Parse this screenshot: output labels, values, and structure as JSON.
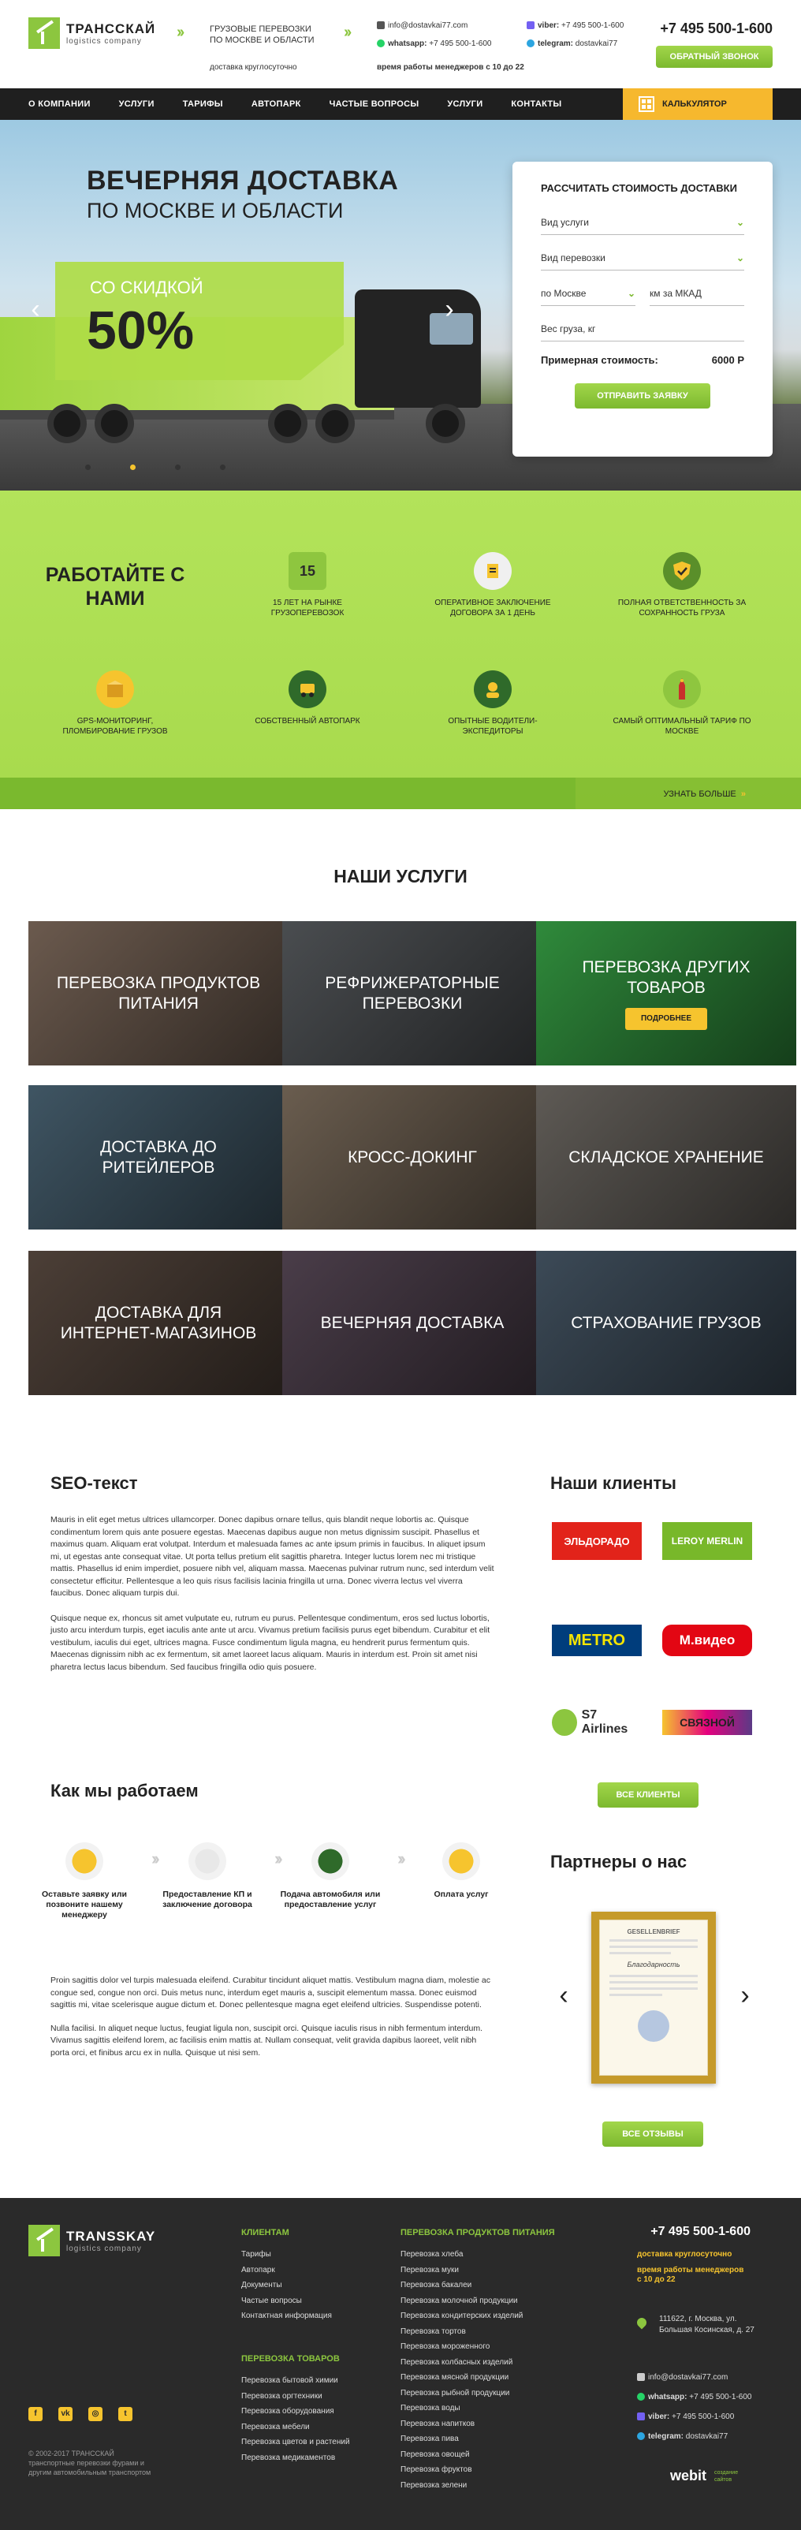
{
  "header": {
    "brand_name": "ТРАНССКАЙ",
    "brand_sub": "logistics company",
    "tagline_line1": "ГРУЗОВЫЕ ПЕРЕВОЗКИ",
    "tagline_line2": "ПО МОСКВЕ И ОБЛАСТИ",
    "hours_note": "доставка круглосуточно",
    "email": "info@dostavkai77.com",
    "whatsapp_label": "whatsapp:",
    "whatsapp": "+7 495 500-1-600",
    "manager_hours": "время работы менеджеров с 10 до 22",
    "viber_label": "viber:",
    "viber": "+7 495 500-1-600",
    "telegram_label": "telegram:",
    "telegram": "dostavkai77",
    "phone": "+7 495 500-1-600",
    "callback_label": "ОБРАТНЫЙ ЗВОНОК"
  },
  "nav": {
    "items": [
      "О КОМПАНИИ",
      "УСЛУГИ",
      "ТАРИФЫ",
      "АВТОПАРК",
      "ЧАСТЫЕ ВОПРОСЫ",
      "УСЛУГИ",
      "КОНТАКТЫ"
    ],
    "calculator_label": "КАЛЬКУЛЯТОР"
  },
  "hero": {
    "title": "ВЕЧЕРНЯЯ ДОСТАВКА",
    "subtitle": "ПО МОСКВЕ И ОБЛАСТИ",
    "discount_label": "СО СКИДКОЙ",
    "discount_value": "50%",
    "slides_total": 4,
    "active_slide": 2
  },
  "calc_form": {
    "title": "РАССЧИТАТЬ СТОИМОСТЬ ДОСТАВКИ",
    "service_field": "Вид услуги",
    "transport_field": "Вид перевозки",
    "region_field": "по Москве",
    "distance_placeholder": "км за МКАД",
    "weight_placeholder": "Вес груза, кг",
    "total_label": "Примерная стоимость:",
    "total_value": "6000 Р",
    "submit_label": "ОТПРАВИТЬ ЗАЯВКУ"
  },
  "benefits": {
    "title": "РАБОТАЙТЕ С НАМИ",
    "items": [
      {
        "label": "15 ЛЕТ НА РЫНКЕ ГРУЗОПЕРЕВОЗОК",
        "icon": "15-years-icon"
      },
      {
        "label": "ОПЕРАТИВНОЕ ЗАКЛЮЧЕНИЕ ДОГОВОРА ЗА 1 ДЕНЬ",
        "icon": "contract-icon"
      },
      {
        "label": "ПОЛНАЯ ОТВЕТСТВЕННОСТЬ ЗА СОХРАННОСТЬ ГРУЗА",
        "icon": "shield-icon"
      },
      {
        "label": "GPS-МОНИТОРИНГ, ПЛОМБИРОВАНИЕ ГРУЗОВ",
        "icon": "gps-box-icon"
      },
      {
        "label": "СОБСТВЕННЫЙ АВТОПАРК",
        "icon": "truck-icon"
      },
      {
        "label": "ОПЫТНЫЕ ВОДИТЕЛИ-ЭКСПЕДИТОРЫ",
        "icon": "driver-icon"
      },
      {
        "label": "САМЫЙ ОПТИМАЛЬНЫЙ ТАРИФ ПО МОСКВЕ",
        "icon": "kremlin-icon"
      }
    ],
    "learn_more": "УЗНАТЬ БОЛЬШЕ"
  },
  "services": {
    "title": "НАШИ УСЛУГИ",
    "items": [
      {
        "label": "ПЕРЕВОЗКА ПРОДУКТОВ ПИТАНИЯ",
        "color": "#6b5a4e"
      },
      {
        "label": "РЕФРИЖЕРАТОРНЫЕ ПЕРЕВОЗКИ",
        "color": "#4a4d50"
      },
      {
        "label": "ПЕРЕВОЗКА ДРУГИХ ТОВАРОВ",
        "color": "#2f8a3b"
      },
      {
        "label": "ДОСТАВКА ДО РИТЕЙЛЕРОВ",
        "color": "#3f5563"
      },
      {
        "label": "КРОСС-ДОКИНГ",
        "color": "#6a5d4f"
      },
      {
        "label": "СКЛАДСКОЕ ХРАНЕНИЕ",
        "color": "#5e5a55"
      },
      {
        "label": "ДОСТАВКА ДЛЯ ИНТЕРНЕТ-МАГАЗИНОВ",
        "color": "#4c3f37"
      },
      {
        "label": "ВЕЧЕРНЯЯ ДОСТАВКА",
        "color": "#4a3d49"
      },
      {
        "label": "СТРАХОВАНИЕ ГРУЗОВ",
        "color": "#3c4a57"
      }
    ],
    "more_label": "ПОДРОБНЕЕ"
  },
  "seo": {
    "title": "SEO-текст",
    "p1": "Mauris in elit eget metus ultrices ullamcorper. Donec dapibus ornare tellus, quis blandit neque lobortis ac. Quisque condimentum lorem quis ante posuere egestas. Maecenas dapibus augue non metus dignissim suscipit. Phasellus et maximus quam. Aliquam erat volutpat. Interdum et malesuada fames ac ante ipsum primis in faucibus. In aliquet ipsum mi, ut egestas ante consequat vitae. Ut porta tellus pretium elit sagittis pharetra. Integer luctus lorem nec mi tristique mattis. Phasellus id enim imperdiet, posuere nibh vel, aliquam massa. Maecenas pulvinar rutrum nunc, sed interdum velit consectetur efficitur. Pellentesque a leo quis risus facilisis lacinia fringilla ut urna. Donec viverra lectus vel viverra faucibus. Donec aliquam turpis dui.",
    "p2": "Quisque neque ex, rhoncus sit amet vulputate eu, rutrum eu purus. Pellentesque condimentum, eros sed luctus lobortis, justo arcu interdum turpis, eget iaculis ante ante ut arcu. Vivamus pretium facilisis purus eget bibendum. Curabitur et elit vestibulum, iaculis dui eget, ultrices magna. Fusce condimentum ligula magna, eu hendrerit purus fermentum quis. Maecenas dignissim nibh ac ex fermentum, sit amet laoreet lacus aliquam. Mauris in interdum est. Proin sit amet nisi pharetra lectus lacus bibendum. Sed faucibus fringilla odio quis posuere."
  },
  "clients": {
    "title": "Наши клиенты",
    "logos": [
      {
        "name": "ЭЛЬДОРАДО",
        "color": "#e2231a"
      },
      {
        "name": "LEROY MERLIN",
        "color": "#78b82a"
      },
      {
        "name": "METRO",
        "color": "#003d7c"
      },
      {
        "name": "М.видео",
        "color": "#e30613"
      },
      {
        "name": "S7 Airlines",
        "color": "#8cc63f"
      },
      {
        "name": "СВЯЗНОЙ",
        "color": "#5b3a86"
      }
    ],
    "all_label": "ВСЕ КЛИЕНТЫ"
  },
  "how": {
    "title": "Как мы работаем",
    "steps": [
      {
        "label": "Оставьте заявку или позвоните нашему менеджеру",
        "icon": "request-icon"
      },
      {
        "label": "Предоставление КП и заключение договора",
        "icon": "certificate-icon"
      },
      {
        "label": "Подача автомобиля или предоставление услуг",
        "icon": "truck-icon"
      },
      {
        "label": "Оплата услуг",
        "icon": "wallet-icon"
      }
    ],
    "p1": "Proin sagittis dolor vel turpis malesuada eleifend. Curabitur tincidunt aliquet mattis. Vestibulum magna diam, molestie ac congue sed, congue non orci. Duis metus nunc, interdum eget mauris a, suscipit elementum massa. Donec euismod sagittis mi, vitae scelerisque augue dictum et. Donec pellentesque magna eget eleifend ultricies. Suspendisse potenti.",
    "p2": "Nulla facilisi. In aliquet neque luctus, feugiat ligula non, suscipit orci. Quisque iaculis risus in nibh fermentum interdum. Vivamus sagittis eleifend lorem, ac facilisis enim mattis at. Nullam consequat, velit gravida dapibus laoreet, velit nibh porta orci, et finibus arcu ex in nulla. Quisque ut nisi sem."
  },
  "partners": {
    "title": "Партнеры о нас",
    "cert_head": "GESELLENBRIEF",
    "cert_mid": "Благодарность",
    "reviews_label": "ВСЕ ОТЗЫВЫ"
  },
  "footer": {
    "brand_name": "TRANSSKAY",
    "brand_sub": "logistics company",
    "clients_title": "КЛИЕНТАМ",
    "clients_links": [
      "Тарифы",
      "Автопарк",
      "Документы",
      "Частые вопросы",
      "Контактная информация"
    ],
    "goods_title": "ПЕРЕВОЗКА ТОВАРОВ",
    "goods_links": [
      "Перевозка бытовой химии",
      "Перевозка оргтехники",
      "Перевозка оборудования",
      "Перевозка мебели",
      "Перевозка цветов и растений",
      "Перевозка медикаментов"
    ],
    "food_title": "ПЕРЕВОЗКА ПРОДУКТОВ ПИТАНИЯ",
    "food_links": [
      "Перевозка хлеба",
      "Перевозка муки",
      "Перевозка бакалеи",
      "Перевозка молочной продукции",
      "Перевозка кондитерских изделий",
      "Перевозка тортов",
      "Перевозка мороженного",
      "Перевозка колбасных изделий",
      "Перевозка мясной продукции",
      "Перевозка рыбной продукции",
      "Перевозка воды",
      "Перевозка напитков",
      "Перевозка пива",
      "Перевозка овощей",
      "Перевозка фруктов",
      "Перевозка зелени"
    ],
    "phone": "+7 495 500-1-600",
    "hours": "доставка круглосуточно",
    "manager_hours": "время работы менеджеров с 10 до 22",
    "address": "111622, г. Москва, ул. Большая Косинская, д. 27",
    "email": "info@dostavkai77.com",
    "whatsapp_label": "whatsapp:",
    "whatsapp": "+7 495 500-1-600",
    "viber_label": "viber:",
    "viber": "+7 495 500-1-600",
    "telegram_label": "telegram:",
    "telegram": "dostavkai77",
    "copyright_line1": "© 2002-2017 ТРАНССКАЙ",
    "copyright_line2": "транспортные перевозки фурами и",
    "copyright_line3": "другим автомобильным транспортом",
    "dev_name": "webit",
    "dev_sub": "создание сайтов",
    "social": [
      "facebook-icon",
      "vk-icon",
      "instagram-icon",
      "twitter-icon"
    ]
  }
}
